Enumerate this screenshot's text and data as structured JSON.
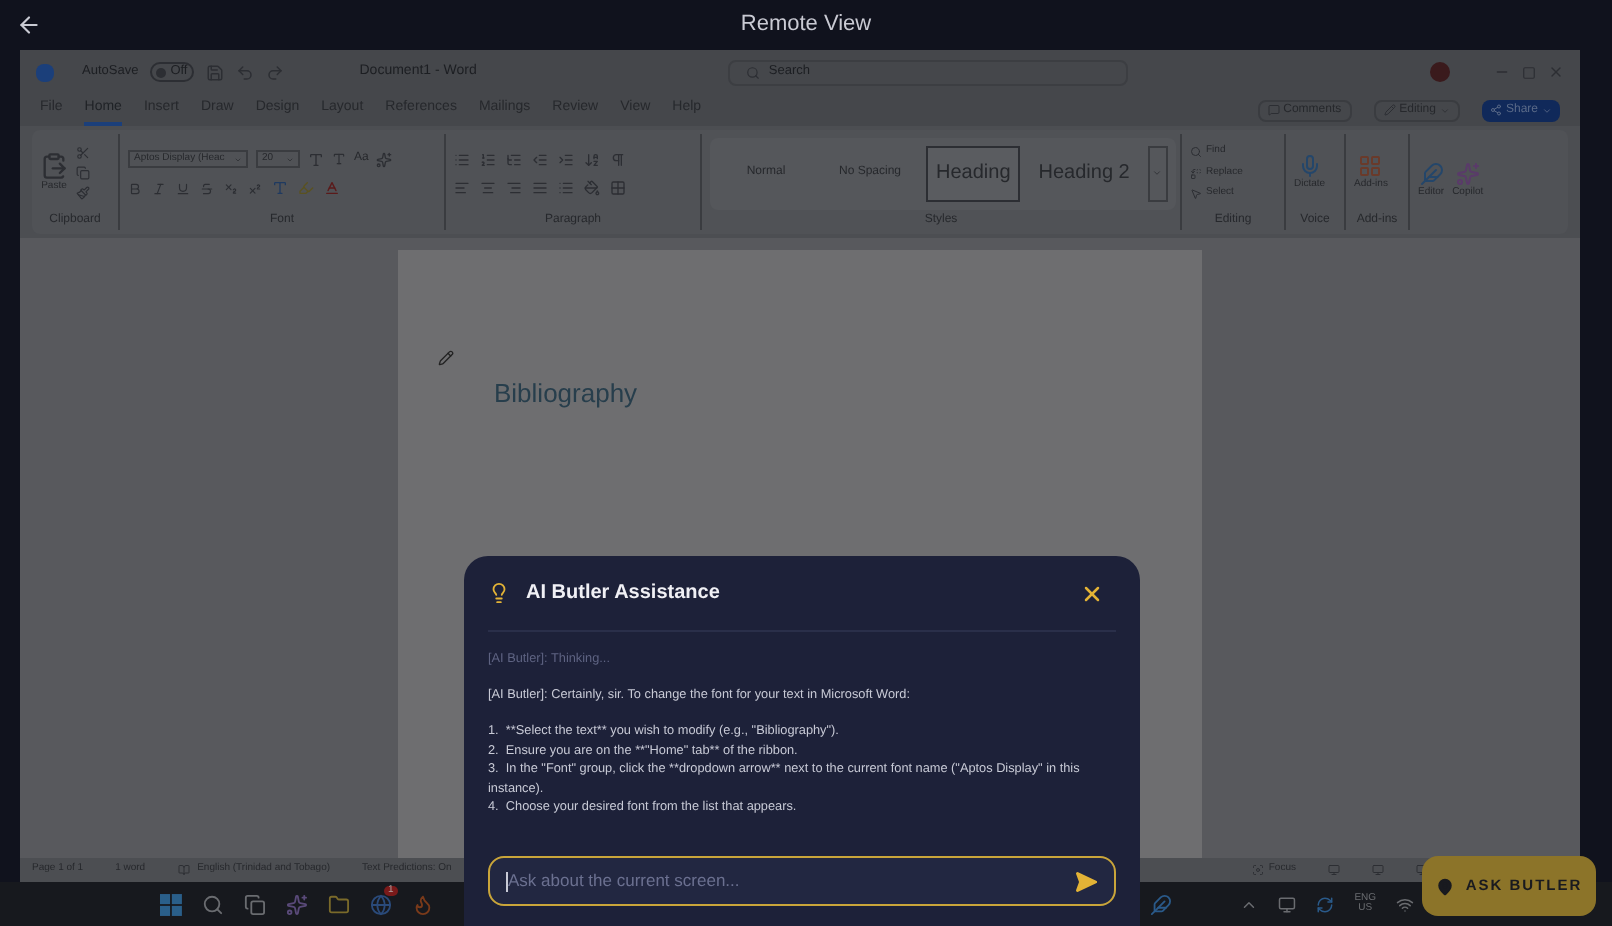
{
  "remote_view": {
    "title": "Remote View"
  },
  "word": {
    "title_bar": {
      "autosave_label": "AutoSave",
      "autosave_state": "Off",
      "autosave_on": false,
      "document_title": "Document1 - Word",
      "search_placeholder": "Search"
    },
    "menu_tabs": [
      {
        "label": "File",
        "selected": false
      },
      {
        "label": "Home",
        "selected": true
      },
      {
        "label": "Insert",
        "selected": false
      },
      {
        "label": "Draw",
        "selected": false
      },
      {
        "label": "Design",
        "selected": false
      },
      {
        "label": "Layout",
        "selected": false
      },
      {
        "label": "References",
        "selected": false
      },
      {
        "label": "Mailings",
        "selected": false
      },
      {
        "label": "Review",
        "selected": false
      },
      {
        "label": "View",
        "selected": false
      },
      {
        "label": "Help",
        "selected": false
      }
    ],
    "menu_actions": {
      "comments": "Comments",
      "editing": "Editing",
      "share": "Share"
    },
    "ribbon": {
      "clipboard": {
        "paste": "Paste",
        "group_label": "Clipboard"
      },
      "font": {
        "font_name": "Aptos Display (Heac",
        "font_size": "20",
        "case_button": "Aa",
        "group_label": "Font"
      },
      "paragraph": {
        "group_label": "Paragraph"
      },
      "styles": {
        "items": [
          {
            "label": "Normal",
            "selected": false
          },
          {
            "label": "No Spacing",
            "selected": false
          },
          {
            "label": "Heading",
            "selected": true
          },
          {
            "label": "Heading 2",
            "selected": false
          }
        ],
        "group_label": "Styles"
      },
      "editing": {
        "items": [
          "Find",
          "Replace",
          "Select"
        ],
        "group_label": "Editing"
      },
      "voice": {
        "dictate": "Dictate",
        "group_label": "Voice"
      },
      "add_ins": {
        "button": "Add-ins",
        "group_label": "Add-ins"
      },
      "extras": [
        "Editor",
        "Copilot"
      ]
    },
    "document": {
      "heading": "Bibliography"
    },
    "status_bar": {
      "items": [
        "Page 1 of 1",
        "1 word",
        "English (Trinidad and Tobago)",
        "Text Predictions: On"
      ],
      "focus": "Focus"
    }
  },
  "taskbar": {
    "badge": "1",
    "language": "ENG",
    "region": "US"
  },
  "butler_dialog": {
    "title": "AI Butler Assistance",
    "status_message": "[AI Butler]: Thinking...",
    "reply_intro": "[AI Butler]: Certainly, sir. To change the font for your text in Microsoft Word:",
    "steps": [
      {
        "number": "1.",
        "text": "**Select the text** you wish to modify (e.g., \"Bibliography\")."
      },
      {
        "number": "2.",
        "text": "Ensure you are on the **\"Home\" tab** of the ribbon."
      },
      {
        "number": "3.",
        "text": "In the \"Font\" group, click the **dropdown arrow** next to the current font name (\"Aptos Display\" in this instance)."
      },
      {
        "number": "4.",
        "text": "Choose your desired font from the list that appears."
      }
    ],
    "input_placeholder": "Ask about the current screen..."
  },
  "ask_butler_button": {
    "label": "ASK BUTLER"
  }
}
